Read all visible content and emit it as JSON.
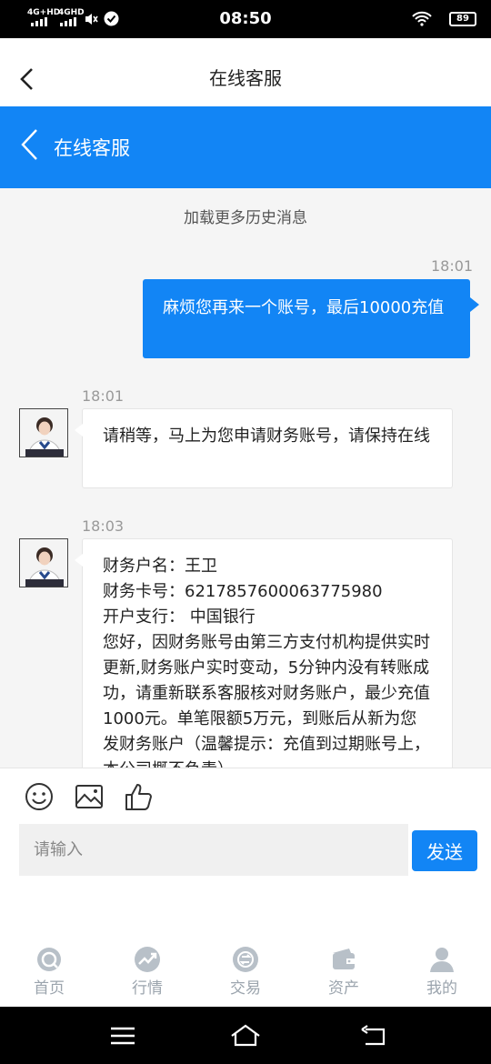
{
  "status_bar": {
    "time": "08:50",
    "network1": "4G+HD",
    "network2": "4GHD",
    "battery": "89"
  },
  "top_nav": {
    "title": "在线客服"
  },
  "blue_header": {
    "title": "在线客服"
  },
  "chat": {
    "load_more": "加载更多历史消息",
    "messages": [
      {
        "direction": "out",
        "time": "18:01",
        "text": "麻烦您再来一个账号，最后10000充值"
      },
      {
        "direction": "in",
        "time": "18:01",
        "text": "请稍等，马上为您申请财务账号，请保持在线"
      },
      {
        "direction": "in",
        "time": "18:03",
        "lines": [
          "财务户名：王卫",
          "财务卡号：6217857600063775980",
          "开户支行： 中国银行",
          "您好，因财务账号由第三方支付机构提供实时更新,财务账户实时变动，5分钟内没有转账成功，请重新联系客服核对财务账户，最少充值1000元。单笔限额5万元，到账后从新为您发财务账户（温馨提示：充值到过期账号上，本公司概不负责）"
        ]
      }
    ]
  },
  "composer": {
    "tools": [
      "emoji-icon",
      "image-icon",
      "thumbs-up-icon"
    ],
    "placeholder": "请输入",
    "send_label": "发送"
  },
  "tab_bar": {
    "items": [
      {
        "label": "首页",
        "icon": "home-icon"
      },
      {
        "label": "行情",
        "icon": "market-icon"
      },
      {
        "label": "交易",
        "icon": "trade-icon"
      },
      {
        "label": "资产",
        "icon": "wallet-icon"
      },
      {
        "label": "我的",
        "icon": "user-icon"
      }
    ]
  },
  "colors": {
    "accent": "#1285f5",
    "tab_inactive": "#9ba4ad"
  }
}
